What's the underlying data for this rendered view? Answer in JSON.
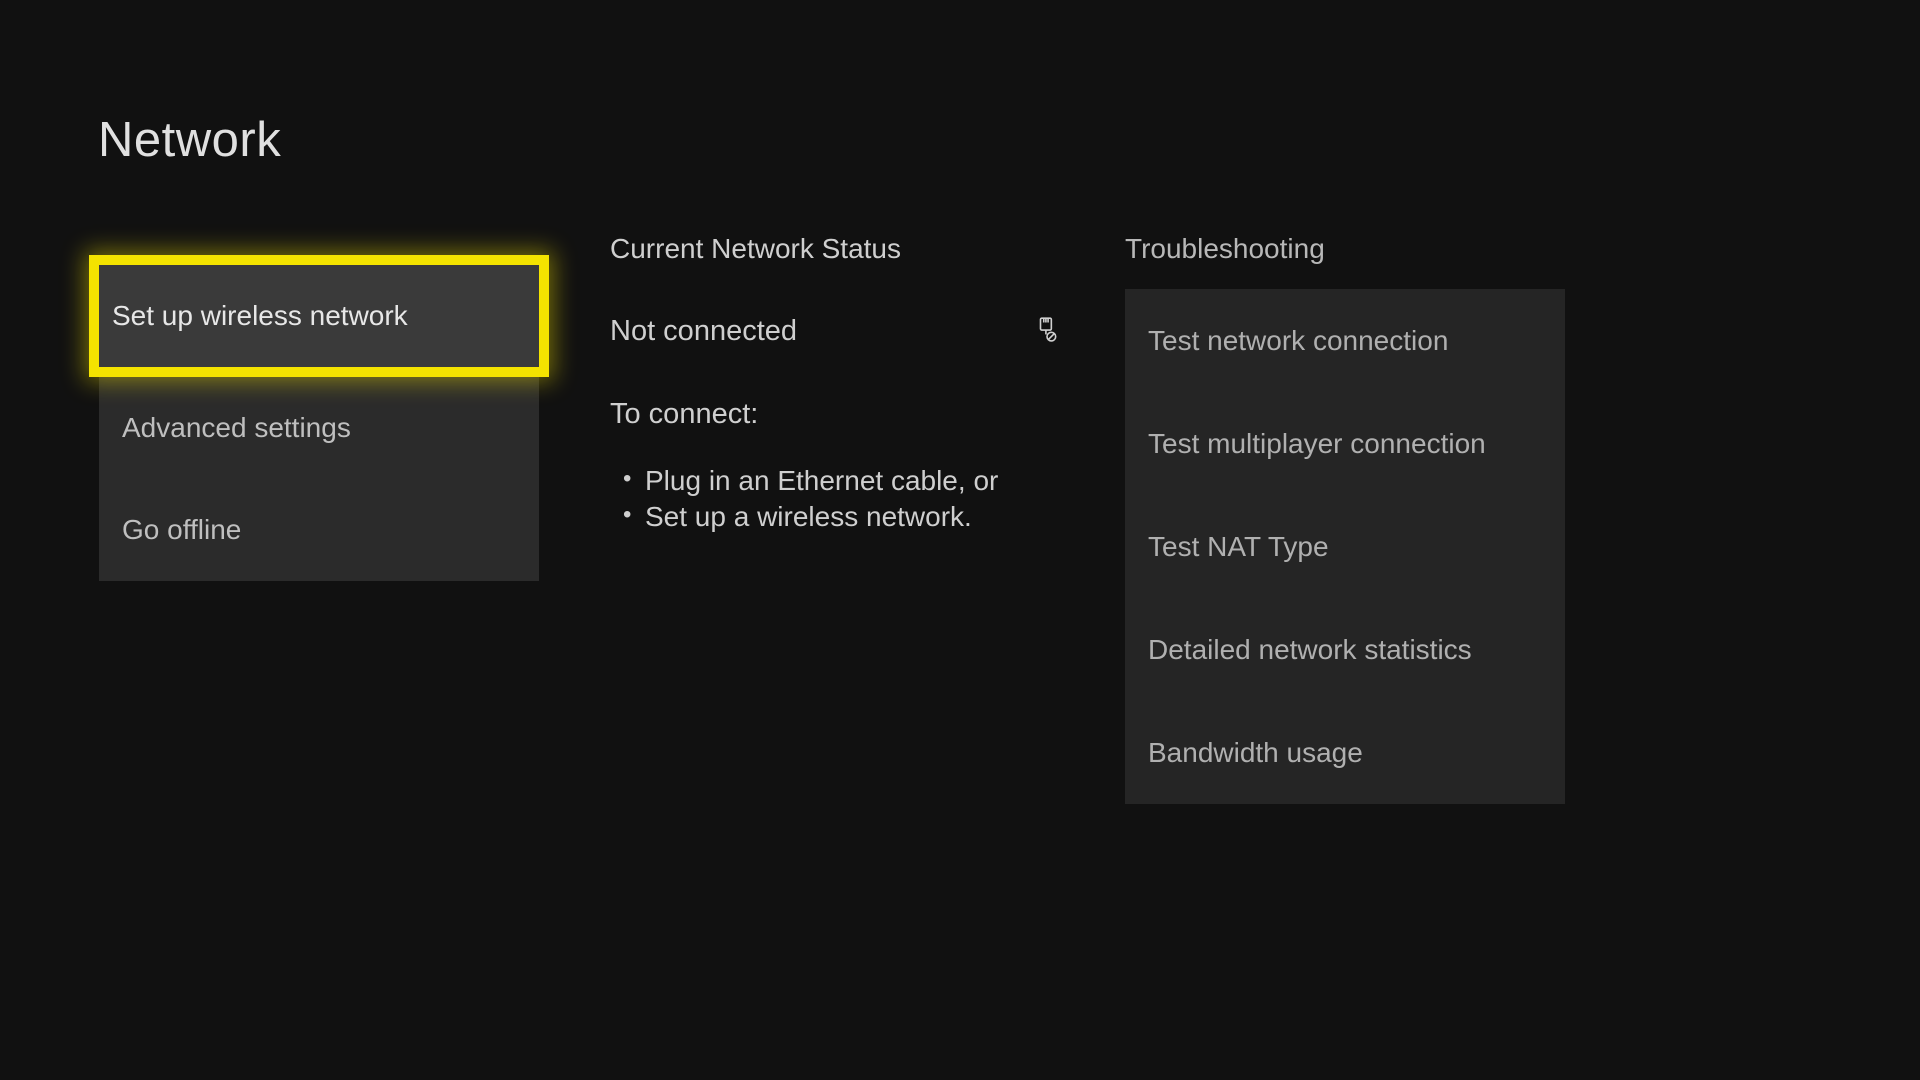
{
  "title": "Network",
  "leftActions": [
    {
      "label": "Set up wireless network",
      "selected": true
    },
    {
      "label": "Advanced settings",
      "selected": false
    },
    {
      "label": "Go offline",
      "selected": false
    }
  ],
  "status": {
    "heading": "Current Network Status",
    "state": "Not connected",
    "connectLabel": "To connect:",
    "bullets": [
      "Plug in an Ethernet cable, or",
      "Set up a wireless network."
    ]
  },
  "troubleshooting": {
    "heading": "Troubleshooting",
    "items": [
      "Test network connection",
      "Test multiplayer connection",
      "Test NAT Type",
      "Detailed network statistics",
      "Bandwidth usage"
    ]
  }
}
